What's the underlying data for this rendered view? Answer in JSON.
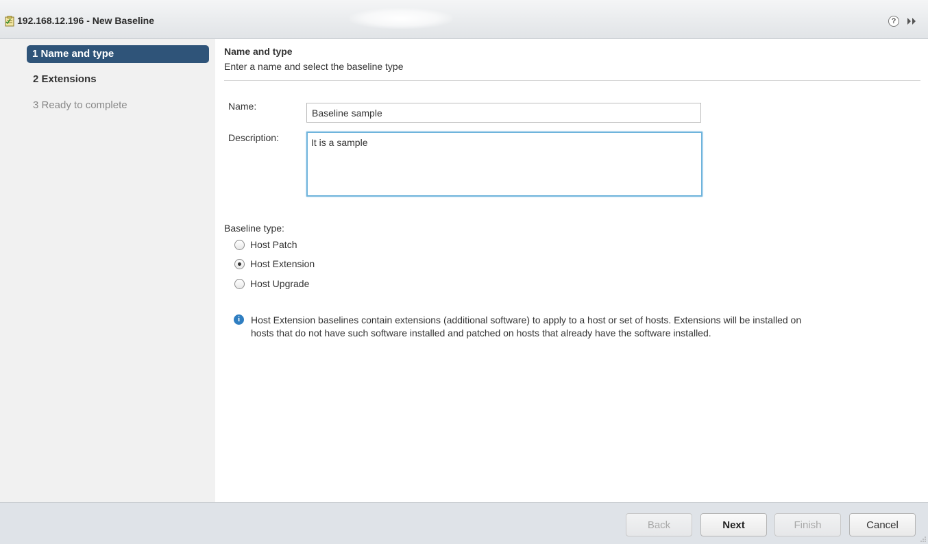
{
  "window": {
    "title": "192.168.12.196 - New Baseline",
    "icon": "baseline-icon",
    "help_glyph": "?"
  },
  "steps": [
    {
      "label": "1 Name and type",
      "state": "active"
    },
    {
      "label": "2 Extensions",
      "state": "normal"
    },
    {
      "label": "3 Ready to complete",
      "state": "disabled"
    }
  ],
  "page": {
    "title": "Name and type",
    "subtitle": "Enter a name and select the baseline type"
  },
  "form": {
    "name_label": "Name:",
    "name_value": "Baseline sample",
    "description_label": "Description:",
    "description_value": "It is a sample",
    "baseline_type_label": "Baseline type:",
    "baseline_types": [
      {
        "label": "Host Patch",
        "selected": false
      },
      {
        "label": "Host Extension",
        "selected": true
      },
      {
        "label": "Host Upgrade",
        "selected": false
      }
    ]
  },
  "info": {
    "glyph": "i",
    "text": "Host Extension baselines contain extensions (additional software) to apply to a host or set of hosts. Extensions will be installed on hosts that do not have such software installed and patched on hosts that already have the software installed."
  },
  "buttons": {
    "back": "Back",
    "next": "Next",
    "finish": "Finish",
    "cancel": "Cancel"
  },
  "colors": {
    "active_step_bg": "#2f5479",
    "focus_border": "#6fb4dc",
    "info_icon": "#2f7ec1"
  }
}
